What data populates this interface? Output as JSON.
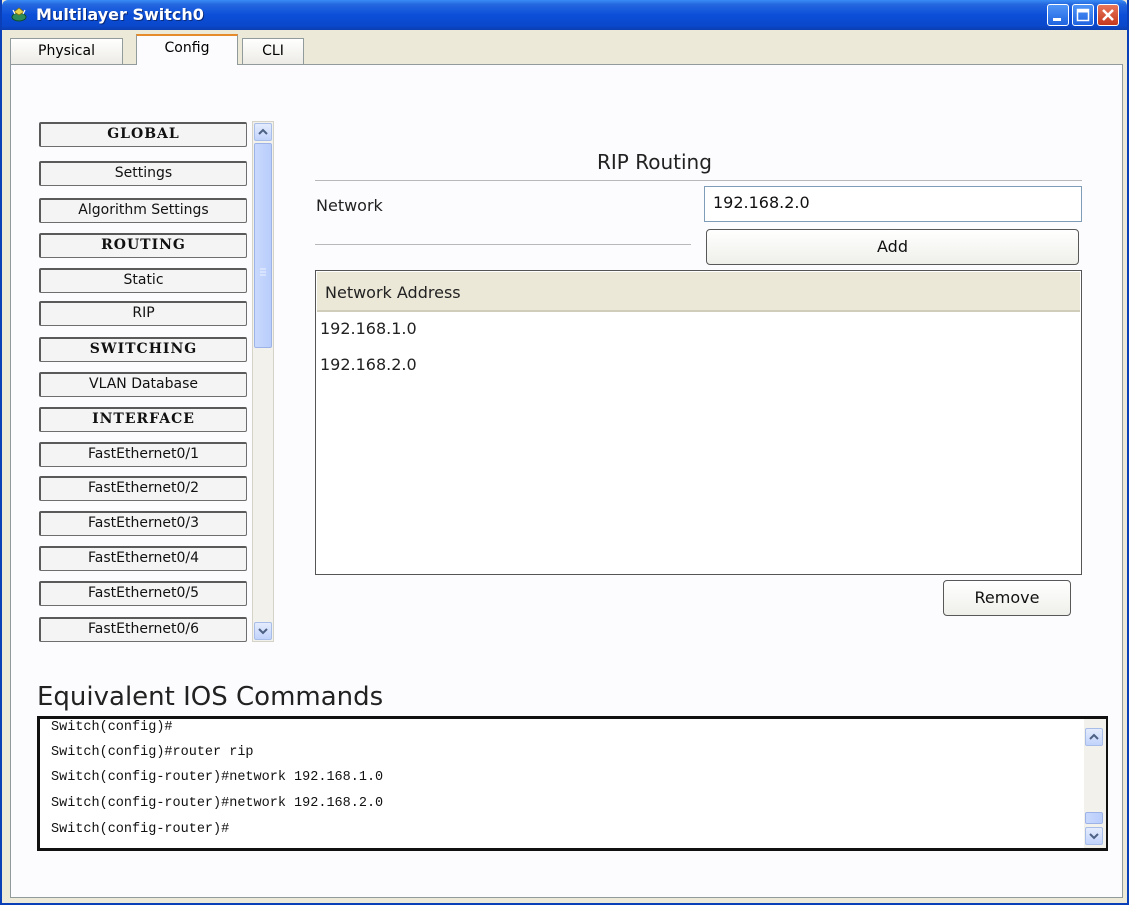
{
  "window": {
    "title": "Multilayer Switch0",
    "accent": "#0c4fd8",
    "tab_accent": "#e68b2c"
  },
  "tabs": [
    {
      "label": "Physical",
      "active": false
    },
    {
      "label": "Config",
      "active": true
    },
    {
      "label": "CLI",
      "active": false
    }
  ],
  "sidebar": {
    "items": [
      {
        "label": "GLOBAL",
        "type": "header"
      },
      {
        "label": "Settings",
        "type": "item"
      },
      {
        "label": "Algorithm Settings",
        "type": "item"
      },
      {
        "label": "ROUTING",
        "type": "header"
      },
      {
        "label": "Static",
        "type": "item"
      },
      {
        "label": "RIP",
        "type": "item"
      },
      {
        "label": "SWITCHING",
        "type": "header"
      },
      {
        "label": "VLAN Database",
        "type": "item"
      },
      {
        "label": "INTERFACE",
        "type": "header"
      },
      {
        "label": "FastEthernet0/1",
        "type": "item"
      },
      {
        "label": "FastEthernet0/2",
        "type": "item"
      },
      {
        "label": "FastEthernet0/3",
        "type": "item"
      },
      {
        "label": "FastEthernet0/4",
        "type": "item"
      },
      {
        "label": "FastEthernet0/5",
        "type": "item"
      },
      {
        "label": "FastEthernet0/6",
        "type": "item"
      }
    ]
  },
  "rip": {
    "title": "RIP Routing",
    "network_label": "Network",
    "network_value": "192.168.2.0",
    "add_label": "Add",
    "table_header": "Network Address",
    "networks": [
      "192.168.1.0",
      "192.168.2.0"
    ],
    "remove_label": "Remove"
  },
  "ios": {
    "title": "Equivalent IOS Commands",
    "lines": [
      "Switch(config)#",
      "Switch(config)#router rip",
      "Switch(config-router)#network 192.168.1.0",
      "Switch(config-router)#network 192.168.2.0",
      "Switch(config-router)#"
    ]
  }
}
